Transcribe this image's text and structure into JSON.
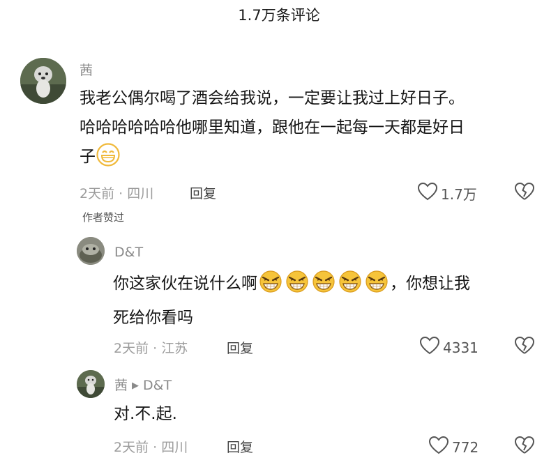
{
  "header": {
    "title": "1.7万条评论"
  },
  "comments": [
    {
      "username": "茜",
      "text_parts": [
        "我老公偶尔喝了酒会给我说，一定要让我过上好日子。",
        "哈哈哈哈哈哈他哪里知道，跟他在一起每一天都是好日",
        "子"
      ],
      "time": "2天前",
      "location": "四川",
      "reply_label": "回复",
      "likes": "1.7万",
      "author_tag": "作者赞过"
    },
    {
      "username": "D&T",
      "text_parts": [
        "你这家伙在说什么啊",
        "，你想让我",
        "死给你看吗"
      ],
      "time": "2天前",
      "location": "江苏",
      "reply_label": "回复",
      "likes": "4331"
    },
    {
      "username": "茜",
      "reply_to": "D&T",
      "text": "对.不.起.",
      "time": "2天前",
      "location": "四川",
      "reply_label": "回复",
      "likes": "772"
    }
  ],
  "meta_separator": "·",
  "icons": [
    "heart-icon",
    "broken-heart-icon",
    "grin-emoji-icon",
    "evil-grin-emoji-icon"
  ]
}
